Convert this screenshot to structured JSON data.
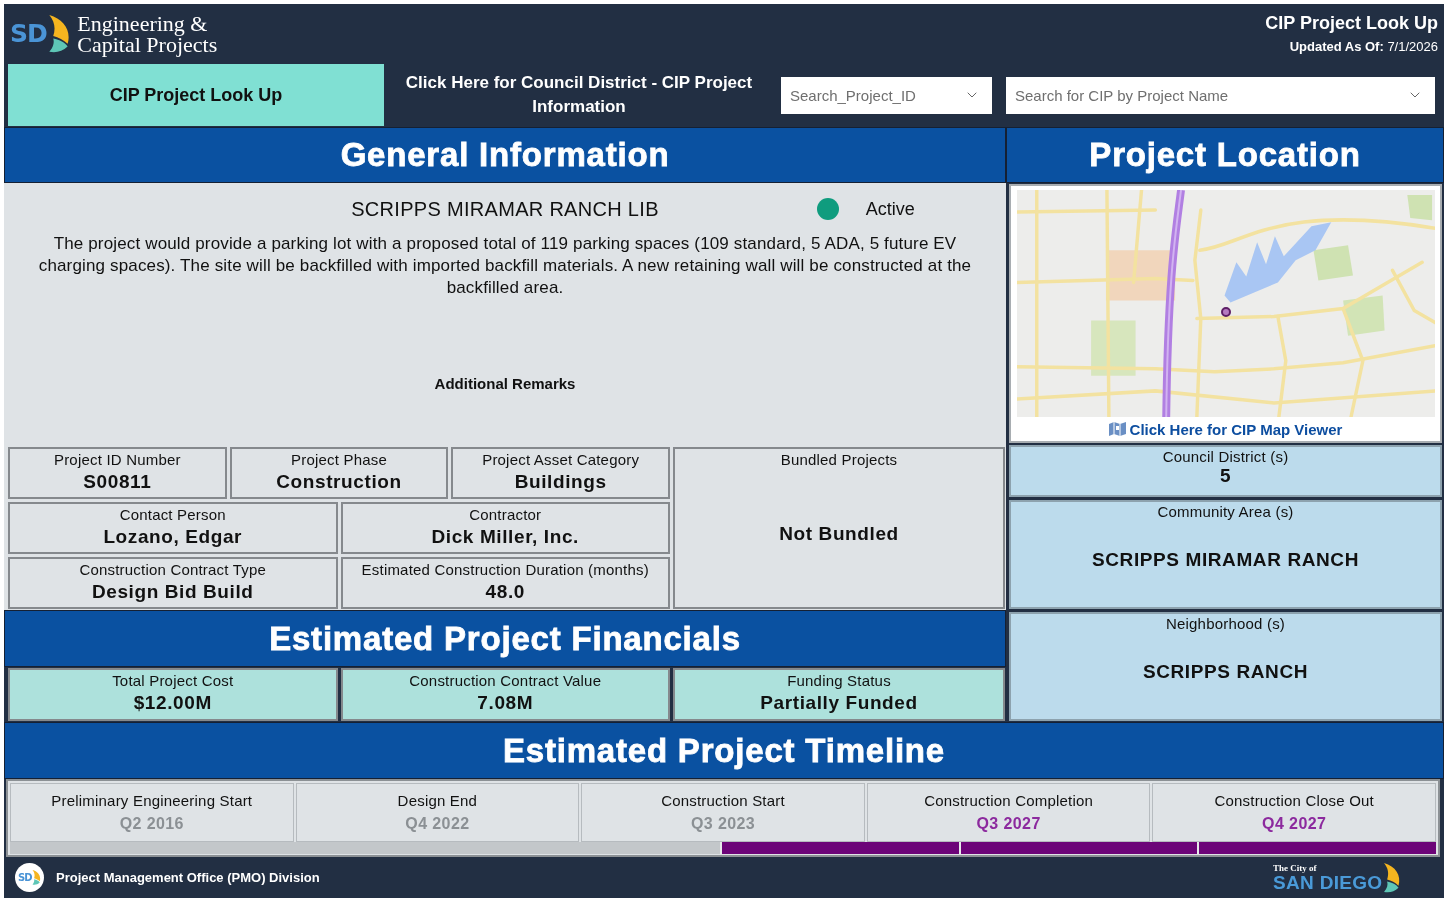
{
  "header": {
    "logo_mark": "SD",
    "brand_title": "Engineering & Capital Projects",
    "page_title": "CIP Project Look Up",
    "updated": "**Updated As Of:** 7/1/2026"
  },
  "nav": {
    "buttons": [
      {
        "label": "CIP Project Look Up",
        "selected": true
      },
      {
        "label": "Click Here for Council District - CIP Project Information",
        "selected": false
      }
    ],
    "dropdowns": [
      {
        "placeholder": "Search_Project_ID"
      },
      {
        "placeholder": "Search for CIP by Project Name"
      }
    ]
  },
  "general_information": {
    "heading": "General Information",
    "project_name": "SCRIPPS MIRAMAR RANCH LIB",
    "status": {
      "label": "Active",
      "color": "#0f9c7e"
    },
    "description": "The project would provide a parking lot with a proposed total of 119 parking spaces (109 standard, 5 ADA, 5 future EV charging spaces). The site will be backfilled with imported backfill materials. A new retaining wall will be constructed at the backfilled area.",
    "remarks_label": "Additional Remarks",
    "field_rows": [
      [
        {
          "label": "Project ID Number",
          "value": "S00811"
        },
        {
          "label": "Project Phase",
          "value": "Construction"
        },
        {
          "label": "Project Asset Category",
          "value": "Buildings"
        }
      ],
      [
        {
          "label": "Contact Person",
          "value": "Lozano, Edgar"
        },
        {
          "label": "Contractor",
          "value": "Dick Miller, Inc."
        }
      ],
      [
        {
          "label": "Construction Contract Type",
          "value": "Design Bid Build"
        },
        {
          "label": "Estimated Construction Duration (months)",
          "value": "48.0"
        }
      ]
    ],
    "bundled": {
      "label": "Bundled Projects",
      "value": "Not Bundled"
    }
  },
  "financials": {
    "heading": "Estimated Project Financials",
    "fields": [
      {
        "label": "Total Project Cost",
        "value": "$12.00M"
      },
      {
        "label": "Construction Contract Value",
        "value": "7.08M"
      },
      {
        "label": "Funding Status",
        "value": "Partially Funded"
      }
    ]
  },
  "project_location": {
    "heading": "Project Location",
    "map_link": "Click Here for CIP Map Viewer",
    "fields": [
      {
        "label": "Council District (s)",
        "value": "5"
      },
      {
        "label": "Community Area (s)",
        "value": "SCRIPPS MIRAMAR RANCH"
      },
      {
        "label": "Neighborhood (s)",
        "value": "SCRIPPS RANCH"
      }
    ]
  },
  "timeline": {
    "heading": "Estimated Project Timeline",
    "milestones": [
      {
        "label": "Preliminary Engineering Start",
        "date": "Q2 2016",
        "upcoming": false
      },
      {
        "label": "Design End",
        "date": "Q4 2022",
        "upcoming": false
      },
      {
        "label": "Construction Start",
        "date": "Q3 2023",
        "upcoming": false
      },
      {
        "label": "Construction Completion",
        "date": "Q3 2027",
        "upcoming": true
      },
      {
        "label": "Construction Close Out",
        "date": "Q4 2027",
        "upcoming": true
      }
    ],
    "progress_segments": [
      {
        "filled": false
      },
      {
        "filled": false
      },
      {
        "filled": false
      },
      {
        "filled": true
      },
      {
        "filled": true
      },
      {
        "filled": true
      }
    ]
  },
  "footer": {
    "logo_mark": "SD",
    "division": "Project Management Office (PMO) Division",
    "city_logo": {
      "prefix": "The City of",
      "name": "SAN DIEGO"
    }
  }
}
